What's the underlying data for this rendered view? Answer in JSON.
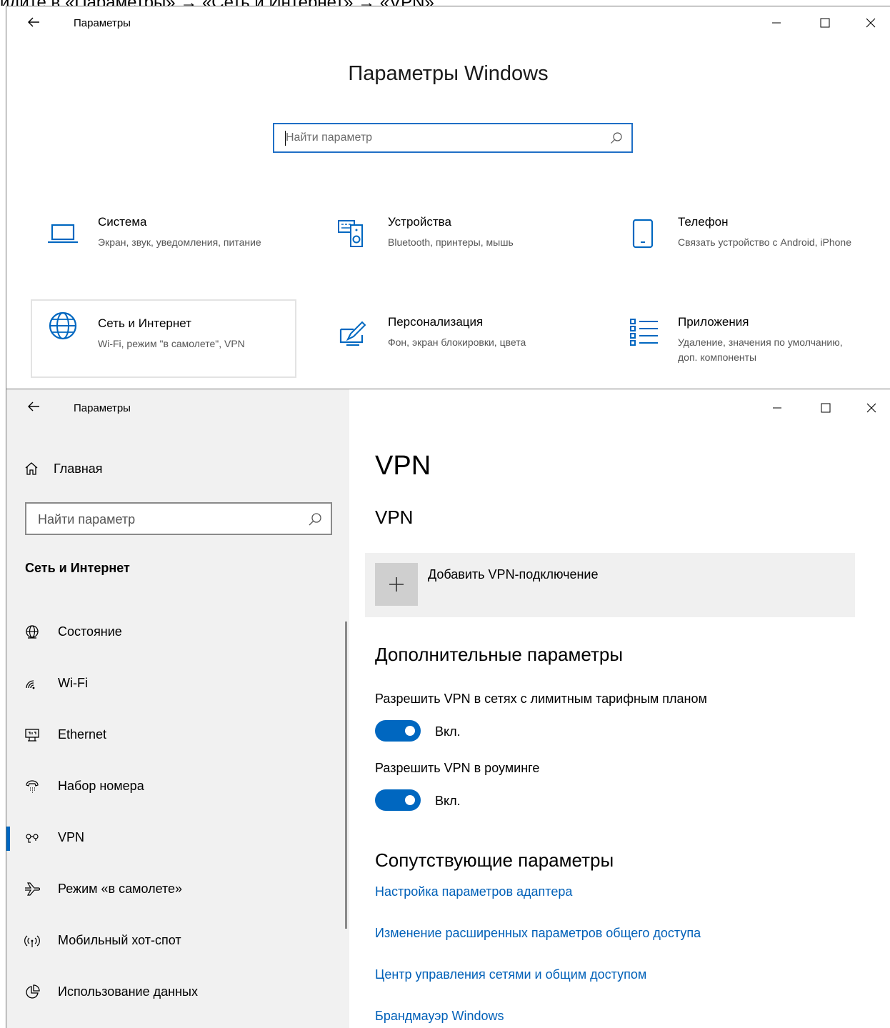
{
  "caption": "йдите в «Параметры» → «Сеть и Интернет» → «VPN».",
  "window1": {
    "title": "Параметры",
    "heading": "Параметры Windows",
    "search_placeholder": "Найти параметр",
    "tiles": [
      {
        "name": "Система",
        "desc": "Экран, звук, уведомления, питание",
        "icon": "laptop-icon"
      },
      {
        "name": "Устройства",
        "desc": "Bluetooth, принтеры, мышь",
        "icon": "devices-icon"
      },
      {
        "name": "Телефон",
        "desc": "Связать устройство с Android, iPhone",
        "icon": "phone-icon"
      },
      {
        "name": "Сеть и Интернет",
        "desc": "Wi-Fi, режим \"в самолете\", VPN",
        "icon": "globe-icon"
      },
      {
        "name": "Персонализация",
        "desc": "Фон, экран блокировки, цвета",
        "icon": "brush-icon"
      },
      {
        "name": "Приложения",
        "desc": "Удаление, значения по умолчанию, доп. компоненты",
        "icon": "apps-list-icon"
      }
    ]
  },
  "window2": {
    "title": "Параметры",
    "sidebar": {
      "home": "Главная",
      "search_placeholder": "Найти параметр",
      "section": "Сеть и Интернет",
      "items": [
        {
          "label": "Состояние",
          "icon": "globe-status-icon"
        },
        {
          "label": "Wi-Fi",
          "icon": "wifi-icon"
        },
        {
          "label": "Ethernet",
          "icon": "ethernet-icon"
        },
        {
          "label": "Набор номера",
          "icon": "dialup-icon"
        },
        {
          "label": "VPN",
          "icon": "vpn-icon"
        },
        {
          "label": "Режим «в самолете»",
          "icon": "airplane-icon"
        },
        {
          "label": "Мобильный хот-спот",
          "icon": "hotspot-icon"
        },
        {
          "label": "Использование данных",
          "icon": "data-usage-icon"
        }
      ],
      "active_index": 4
    },
    "main": {
      "title": "VPN",
      "subtitle": "VPN",
      "add_vpn": "Добавить VPN-подключение",
      "advanced_heading": "Дополнительные параметры",
      "option1_label": "Разрешить VPN в сетях с лимитным тарифным планом",
      "option1_state": "Вкл.",
      "option2_label": "Разрешить VPN в роуминге",
      "option2_state": "Вкл.",
      "related_heading": "Сопутствующие параметры",
      "links": [
        "Настройка параметров адаптера",
        "Изменение расширенных параметров общего доступа",
        "Центр управления сетями и общим доступом",
        "Брандмауэр Windows"
      ]
    }
  },
  "colors": {
    "accent": "#0067c0",
    "link": "#0060b8",
    "sidebar_bg": "#f1f1f1",
    "search_focus_border": "#1f6fc6"
  }
}
